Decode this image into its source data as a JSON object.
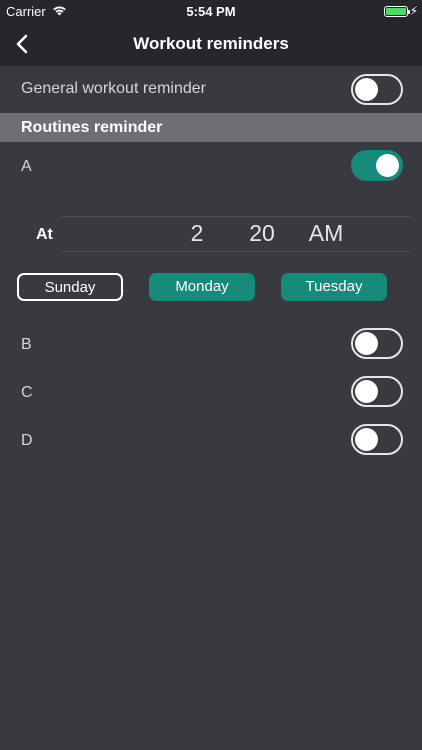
{
  "status_bar": {
    "carrier": "Carrier",
    "time": "5:54 PM",
    "battery_color": "#4cd964"
  },
  "nav": {
    "title": "Workout reminders",
    "back_icon": "chevron-left-icon"
  },
  "general_reminder": {
    "label": "General workout reminder",
    "enabled": false
  },
  "routines": {
    "header": "Routines reminder",
    "items": [
      {
        "label": "A",
        "enabled": true
      },
      {
        "label": "B",
        "enabled": false
      },
      {
        "label": "C",
        "enabled": false
      },
      {
        "label": "D",
        "enabled": false
      }
    ]
  },
  "time_picker": {
    "label": "At",
    "hour": "2",
    "minute": "20",
    "period": "AM"
  },
  "days": [
    {
      "label": "Sunday",
      "selected": false
    },
    {
      "label": "Monday",
      "selected": true
    },
    {
      "label": "Tuesday",
      "selected": true
    }
  ],
  "colors": {
    "accent": "#178a7c",
    "background": "#383a3f",
    "bar": "#25272b",
    "section_header": "#6d6f73"
  }
}
